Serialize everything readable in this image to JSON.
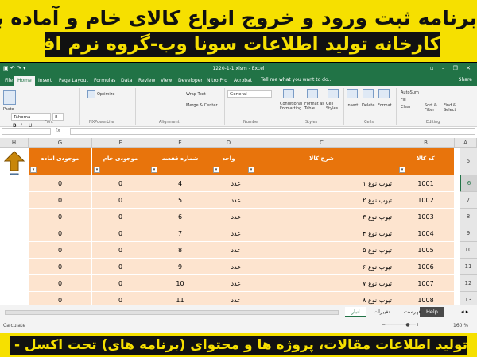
{
  "banner": {
    "line1": "برنامه ثبت ورود و خروج انواع کالای خام و آماده به انبار با شماره بایگانی",
    "line2": "کارخانه تولید اطلاعات سونا وب-گروه نرم افزاری آریان",
    "bottom": "تولید اطلاعات مقالات، پروژه ها و محتوای (برنامه های) تحت اکسل - پاورپوینت - ورد"
  },
  "window": {
    "title": "1220-1-1.xlsm - Excel",
    "qat": "▣ ↶ ↷ ▾",
    "controls": "▫ – ❐ ✕"
  },
  "menu": {
    "tabs": [
      "File",
      "Home",
      "Insert",
      "Page Layout",
      "Formulas",
      "Data",
      "Review",
      "View",
      "Developer",
      "Nitro Pro",
      "Acrobat"
    ],
    "tellme": "Tell me what you want to do...",
    "share": "Share"
  },
  "ribbon": {
    "paste": "Paste",
    "font_name": "Tahoma",
    "font_size": "8",
    "bold": "B",
    "italic": "I",
    "underline": "U",
    "optimize": "Optimize",
    "wrap_text": "Wrap Text",
    "merge_center": "Merge & Center",
    "number_format": "General",
    "conditional": "Conditional Formatting",
    "format_table": "Format as Table",
    "cell_styles": "Cell Styles",
    "insert": "Insert",
    "delete": "Delete",
    "format": "Format",
    "autosum": "AutoSum",
    "fill": "Fill",
    "clear": "Clear",
    "sort_filter": "Sort & Filter",
    "find_select": "Find & Select",
    "groups": [
      "Font",
      "NXPowerLite",
      "Alignment",
      "Number",
      "Styles",
      "Cells",
      "Editing"
    ]
  },
  "formula": {
    "fx": "fx",
    "name": "",
    "value": ""
  },
  "columns": [
    "H",
    "G",
    "F",
    "E",
    "D",
    "C",
    "B",
    "A"
  ],
  "table": {
    "headers": [
      "موجودی آماده",
      "موجودی خام",
      "شماره قفسه",
      "واحد",
      "شرح کالا",
      "کد کالا"
    ],
    "rows": [
      [
        "0",
        "0",
        "4",
        "عدد",
        "تیوپ نوع ۱",
        "1001"
      ],
      [
        "0",
        "0",
        "5",
        "عدد",
        "تیوپ نوع ۲",
        "1002"
      ],
      [
        "0",
        "0",
        "6",
        "عدد",
        "تیوپ نوع ۳",
        "1003"
      ],
      [
        "0",
        "0",
        "7",
        "عدد",
        "تیوپ نوع ۴",
        "1004"
      ],
      [
        "0",
        "0",
        "8",
        "عدد",
        "تیوپ نوع ۵",
        "1005"
      ],
      [
        "0",
        "0",
        "9",
        "عدد",
        "تیوپ نوع ۶",
        "1006"
      ],
      [
        "0",
        "0",
        "10",
        "عدد",
        "تیوپ نوع ۷",
        "1007"
      ],
      [
        "0",
        "0",
        "11",
        "عدد",
        "تیوپ نوع ۸",
        "1008"
      ]
    ],
    "row_numbers": [
      "5",
      "6",
      "7",
      "8",
      "9",
      "10",
      "11",
      "12",
      "13"
    ],
    "selected_row": "6"
  },
  "sheets": {
    "help": "Help",
    "list": "فهرست",
    "changes": "تغییرات",
    "store": "انبار"
  },
  "status": {
    "left": "Calculate",
    "zoom": "160 %"
  },
  "colors": {
    "excel_green": "#217346",
    "header_orange": "#e8740c",
    "row_peach": "#fde4cf",
    "banner_yellow": "#f6e000"
  }
}
